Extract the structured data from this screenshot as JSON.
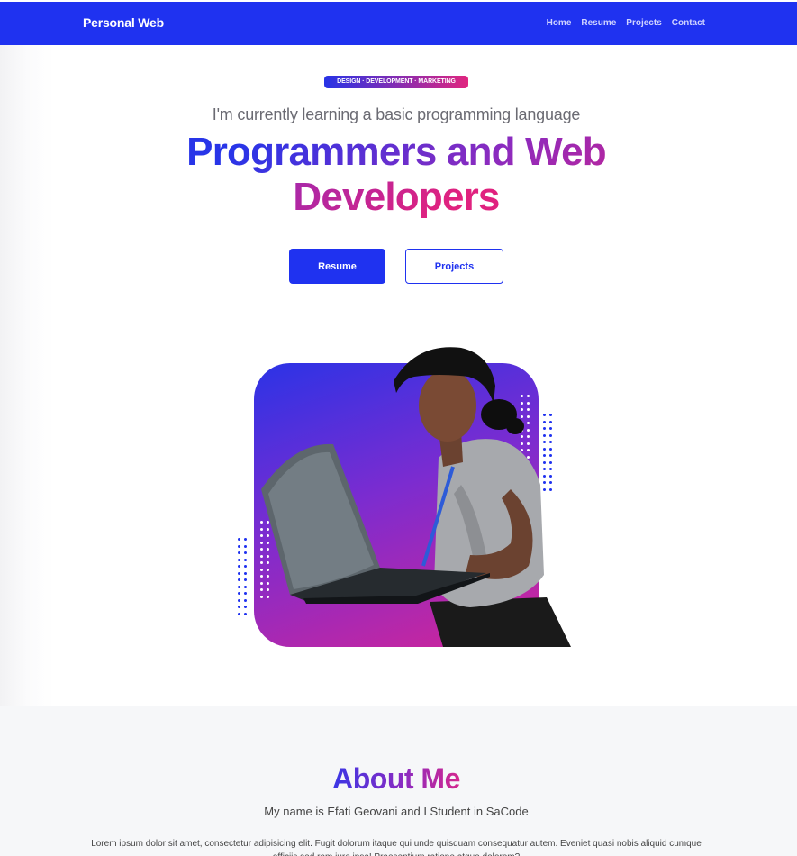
{
  "navbar": {
    "brand": "Personal Web",
    "links": [
      "Home",
      "Resume",
      "Projects",
      "Contact"
    ],
    "bg_color": "#1f32f0"
  },
  "hero": {
    "badge": "DESIGN · DEVELOPMENT · MARKETING",
    "subtitle": "I'm currently learning a basic programming language",
    "title": "Programmers and Web Developers",
    "buttons": {
      "primary": "Resume",
      "secondary": "Projects"
    },
    "gradient": [
      "#2835e8",
      "#8b2bbf",
      "#e0227f"
    ]
  },
  "about": {
    "title": "About Me",
    "subtitle": "My name is Efati Geovani and I Student in SaCode",
    "body": "Lorem ipsum dolor sit amet, consectetur adipisicing elit. Fugit dolorum itaque qui unde quisquam consequatur autem. Eveniet quasi nobis aliquid cumque officiis sed rem iure ipsa! Praesentium ratione atque dolorem?"
  }
}
